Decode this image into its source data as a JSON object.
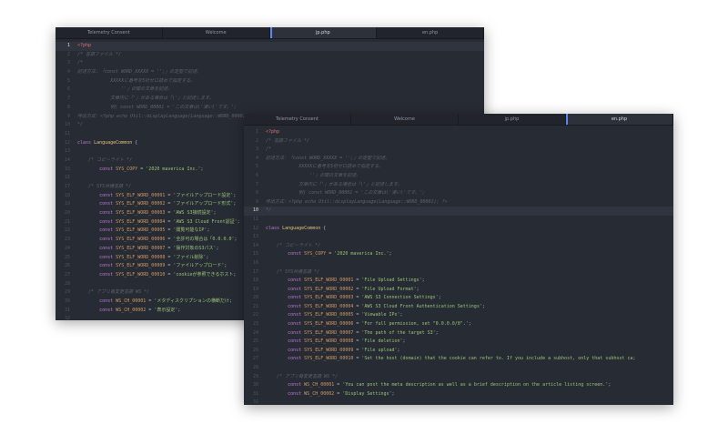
{
  "windows": [
    {
      "tabs": [
        {
          "label": "Telemetry Consent",
          "active": false
        },
        {
          "label": "Welcome",
          "active": false
        },
        {
          "label": "jp.php",
          "active": true
        },
        {
          "label": "en.php",
          "active": false
        }
      ],
      "cursor_line": 1,
      "lines": [
        {
          "n": "1",
          "kind": "tag",
          "indent": 0,
          "text": "<?php"
        },
        {
          "n": "2",
          "kind": "comment",
          "indent": 0,
          "text": "/* 言語ファイル */"
        },
        {
          "n": "3",
          "kind": "comment",
          "indent": 0,
          "text": "/*"
        },
        {
          "n": "4",
          "kind": "comment",
          "indent": 0,
          "text": "記述方法：「const WORD_XXXXX = '';」の定型で記述。"
        },
        {
          "n": "5",
          "kind": "comment",
          "indent": 3,
          "text": "XXXXXに番号を5桁ゼロ詰めで指定する。"
        },
        {
          "n": "6",
          "kind": "comment",
          "indent": 4,
          "text": "''」の間の文章を記述。"
        },
        {
          "n": "7",
          "kind": "comment",
          "indent": 3,
          "text": "文章内に「'」がある場合は「\\'」と記述します。"
        },
        {
          "n": "8",
          "kind": "comment",
          "indent": 3,
          "text": "例) const WORD_00001 = 'この文章は\\'凄い\\'です。';"
        },
        {
          "n": "9",
          "kind": "comment",
          "indent": 0,
          "text": "呼出方式：<?php echo Util::displayLanguage(Language::WORD_00001); ?>"
        },
        {
          "n": "10",
          "kind": "comment",
          "indent": 0,
          "text": "*/"
        },
        {
          "n": "11",
          "kind": "blank",
          "indent": 0,
          "text": ""
        },
        {
          "n": "12",
          "kind": "class",
          "indent": 0,
          "keyword": "class",
          "name": "LanguageCommon",
          "tail": " {"
        },
        {
          "n": "13",
          "kind": "blank",
          "indent": 0,
          "text": ""
        },
        {
          "n": "14",
          "kind": "comment",
          "indent": 1,
          "text": "/* コピーライト */"
        },
        {
          "n": "15",
          "kind": "const",
          "indent": 2,
          "keyword": "const",
          "name": "SYS_COPY",
          "value": "'2020 maverica Inc.'"
        },
        {
          "n": "16",
          "kind": "blank",
          "indent": 0,
          "text": ""
        },
        {
          "n": "17",
          "kind": "comment",
          "indent": 1,
          "text": "/* SYS共通言語 */"
        },
        {
          "n": "18",
          "kind": "const",
          "indent": 2,
          "keyword": "const",
          "name": "SYS_ELF_WORD_00001",
          "value": "'ファイルアップロード設定'"
        },
        {
          "n": "19",
          "kind": "const",
          "indent": 2,
          "keyword": "const",
          "name": "SYS_ELF_WORD_00002",
          "value": "'ファイルアップロード形式'"
        },
        {
          "n": "20",
          "kind": "const",
          "indent": 2,
          "keyword": "const",
          "name": "SYS_ELF_WORD_00003",
          "value": "'AWS S3接続設定'"
        },
        {
          "n": "21",
          "kind": "const",
          "indent": 2,
          "keyword": "const",
          "name": "SYS_ELF_WORD_00004",
          "value": "'AWS S3 Cloud Front認証'"
        },
        {
          "n": "22",
          "kind": "const",
          "indent": 2,
          "keyword": "const",
          "name": "SYS_ELF_WORD_00005",
          "value": "'閲覧可能なIP'"
        },
        {
          "n": "23",
          "kind": "const",
          "indent": 2,
          "keyword": "const",
          "name": "SYS_ELF_WORD_00006",
          "value": "'全許可の場合は「0.0.0.0'"
        },
        {
          "n": "24",
          "kind": "const",
          "indent": 2,
          "keyword": "const",
          "name": "SYS_ELF_WORD_00007",
          "value": "'操作対象のS3パス'"
        },
        {
          "n": "25",
          "kind": "const",
          "indent": 2,
          "keyword": "const",
          "name": "SYS_ELF_WORD_00008",
          "value": "'ファイル削除'"
        },
        {
          "n": "26",
          "kind": "const",
          "indent": 2,
          "keyword": "const",
          "name": "SYS_ELF_WORD_00009",
          "value": "'ファイルアップロード'"
        },
        {
          "n": "27",
          "kind": "const",
          "indent": 2,
          "keyword": "const",
          "name": "SYS_ELF_WORD_00010",
          "value": "'cookieが参照できるホスト"
        },
        {
          "n": "28",
          "kind": "blank",
          "indent": 0,
          "text": ""
        },
        {
          "n": "29",
          "kind": "comment",
          "indent": 1,
          "text": "/* アプリ毎変更言語 WS */"
        },
        {
          "n": "30",
          "kind": "const",
          "indent": 2,
          "keyword": "const",
          "name": "WS_CH_00001",
          "value": "'メタディスクリプションの横断だけ"
        },
        {
          "n": "31",
          "kind": "const",
          "indent": 2,
          "keyword": "const",
          "name": "WS_CH_00002",
          "value": "'表示設定'"
        },
        {
          "n": "32",
          "kind": "blank",
          "indent": 0,
          "text": ""
        },
        {
          "n": "33",
          "kind": "comment",
          "indent": 1,
          "text": "/* アプリ毎変更言語 BIZ基本 */"
        }
      ]
    },
    {
      "tabs": [
        {
          "label": "Telemetry Consent",
          "active": false
        },
        {
          "label": "Welcome",
          "active": false
        },
        {
          "label": "jp.php",
          "active": false
        },
        {
          "label": "en.php",
          "active": true
        }
      ],
      "cursor_line": 10,
      "lines": [
        {
          "n": "1",
          "kind": "tag",
          "indent": 0,
          "text": "<?php"
        },
        {
          "n": "2",
          "kind": "comment",
          "indent": 0,
          "text": "/* 言語ファイル */"
        },
        {
          "n": "3",
          "kind": "comment",
          "indent": 0,
          "text": "/*"
        },
        {
          "n": "4",
          "kind": "comment",
          "indent": 0,
          "text": "記述方法：「const WORD_XXXXX = '';」の定型で記述。"
        },
        {
          "n": "5",
          "kind": "comment",
          "indent": 3,
          "text": "XXXXXに番号を5桁ゼロ詰めで指定する。"
        },
        {
          "n": "6",
          "kind": "comment",
          "indent": 4,
          "text": "''」の間の文章を記述。"
        },
        {
          "n": "7",
          "kind": "comment",
          "indent": 3,
          "text": "文章内に「'」がある場合は「\\'」と記述します。"
        },
        {
          "n": "8",
          "kind": "comment",
          "indent": 3,
          "text": "例) const WORD_00001 = 'この文章は\\'凄い\\'です。';"
        },
        {
          "n": "9",
          "kind": "comment",
          "indent": 0,
          "text": "呼出方式：<?php echo Util::displayLanguage(Language::WORD_00001); ?>"
        },
        {
          "n": "10",
          "kind": "comment",
          "indent": 0,
          "text": "*/"
        },
        {
          "n": "11",
          "kind": "blank",
          "indent": 0,
          "text": ""
        },
        {
          "n": "12",
          "kind": "class",
          "indent": 0,
          "keyword": "class",
          "name": "LanguageCommon",
          "tail": " {"
        },
        {
          "n": "13",
          "kind": "blank",
          "indent": 0,
          "text": ""
        },
        {
          "n": "14",
          "kind": "comment",
          "indent": 1,
          "text": "/* コピーライト */"
        },
        {
          "n": "15",
          "kind": "const",
          "indent": 2,
          "keyword": "const",
          "name": "SYS_COPY",
          "value": "'2020 maverica Inc.'"
        },
        {
          "n": "16",
          "kind": "blank",
          "indent": 0,
          "text": ""
        },
        {
          "n": "17",
          "kind": "comment",
          "indent": 1,
          "text": "/* SYS共通言語 */"
        },
        {
          "n": "18",
          "kind": "const",
          "indent": 2,
          "keyword": "const",
          "name": "SYS_ELF_WORD_00001",
          "value": "'File Upload Settings'"
        },
        {
          "n": "19",
          "kind": "const",
          "indent": 2,
          "keyword": "const",
          "name": "SYS_ELF_WORD_00002",
          "value": "'File Upload Format'"
        },
        {
          "n": "20",
          "kind": "const",
          "indent": 2,
          "keyword": "const",
          "name": "SYS_ELF_WORD_00003",
          "value": "'AWS S3 Connection Settings'"
        },
        {
          "n": "21",
          "kind": "const",
          "indent": 2,
          "keyword": "const",
          "name": "SYS_ELF_WORD_00004",
          "value": "'AWS S3 Cloud Front Authentication Settings'"
        },
        {
          "n": "22",
          "kind": "const",
          "indent": 2,
          "keyword": "const",
          "name": "SYS_ELF_WORD_00005",
          "value": "'Viewable IPs'"
        },
        {
          "n": "23",
          "kind": "const",
          "indent": 2,
          "keyword": "const",
          "name": "SYS_ELF_WORD_00006",
          "value": "'For full permission, set \"0.0.0.0/0\".'"
        },
        {
          "n": "24",
          "kind": "const",
          "indent": 2,
          "keyword": "const",
          "name": "SYS_ELF_WORD_00007",
          "value": "'The path of the target S3'"
        },
        {
          "n": "25",
          "kind": "const",
          "indent": 2,
          "keyword": "const",
          "name": "SYS_ELF_WORD_00008",
          "value": "'File deletion'"
        },
        {
          "n": "26",
          "kind": "const",
          "indent": 2,
          "keyword": "const",
          "name": "SYS_ELF_WORD_00009",
          "value": "'File upload'"
        },
        {
          "n": "27",
          "kind": "const",
          "indent": 2,
          "keyword": "const",
          "name": "SYS_ELF_WORD_00010",
          "value": "'Set the host (domain) that the cookie can refer to. If you include a subhost, only that subhost ca"
        },
        {
          "n": "28",
          "kind": "blank",
          "indent": 0,
          "text": ""
        },
        {
          "n": "29",
          "kind": "comment",
          "indent": 1,
          "text": "/* アプリ毎変更言語 WS */"
        },
        {
          "n": "30",
          "kind": "const",
          "indent": 2,
          "keyword": "const",
          "name": "WS_CH_00001",
          "value": "'You can post the meta description as well as a brief description on the article listing screen.'"
        },
        {
          "n": "31",
          "kind": "const",
          "indent": 2,
          "keyword": "const",
          "name": "WS_CH_00002",
          "value": "'Display Settings'"
        },
        {
          "n": "32",
          "kind": "blank",
          "indent": 0,
          "text": ""
        },
        {
          "n": "33",
          "kind": "comment",
          "indent": 1,
          "text": "/* アプリ毎変更言語 BIZ基本 */"
        }
      ]
    }
  ]
}
